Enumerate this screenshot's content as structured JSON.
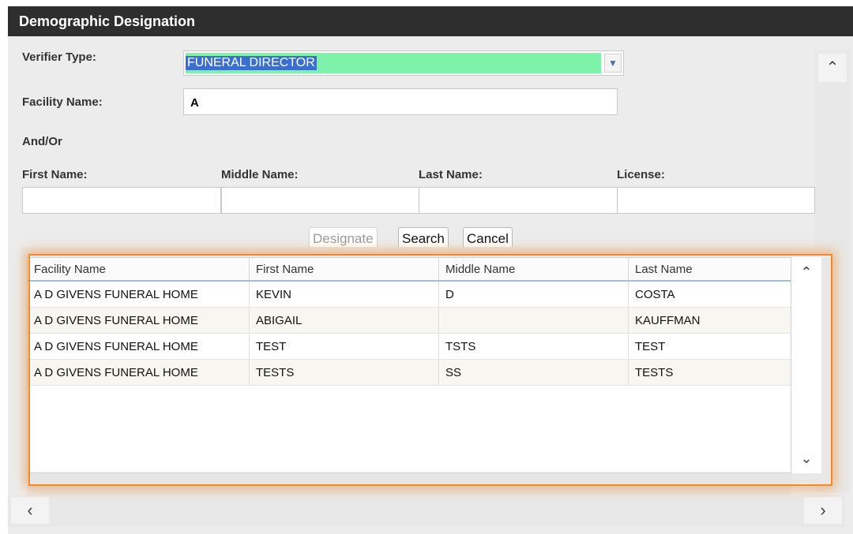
{
  "dialog": {
    "title": "Demographic Designation"
  },
  "form": {
    "verifier_type_label": "Verifier Type:",
    "verifier_type_value": "FUNERAL DIRECTOR",
    "facility_name_label": "Facility Name:",
    "facility_name_value": "A",
    "and_or_label": "And/Or",
    "first_name_label": "First Name:",
    "middle_name_label": "Middle Name:",
    "last_name_label": "Last Name:",
    "license_label": "License:",
    "first_name_value": "",
    "middle_name_value": "",
    "last_name_value": "",
    "license_value": ""
  },
  "buttons": {
    "designate": "Designate",
    "search": "Search",
    "cancel": "Cancel"
  },
  "grid": {
    "columns": [
      "Facility Name",
      "First Name",
      "Middle Name",
      "Last Name"
    ],
    "rows": [
      [
        "A D GIVENS FUNERAL HOME",
        "KEVIN",
        "D",
        "COSTA"
      ],
      [
        "A D GIVENS FUNERAL HOME",
        "ABIGAIL",
        "",
        "KAUFFMAN"
      ],
      [
        "A D GIVENS FUNERAL HOME",
        "TEST",
        "TSTS",
        "TEST"
      ],
      [
        "A D GIVENS FUNERAL HOME",
        "TESTS",
        "SS",
        "TESTS"
      ]
    ]
  },
  "icons": {
    "dropdown": "chevron-down-icon",
    "scroll_up": "chevron-up-icon",
    "scroll_down": "chevron-down-icon",
    "scroll_left": "chevron-left-icon",
    "scroll_right": "chevron-right-icon"
  },
  "colors": {
    "titlebar": "#2e2e2e",
    "select_fill": "#7ff2aa",
    "selection": "#3b6fcf",
    "highlight": "#f08a2c"
  }
}
